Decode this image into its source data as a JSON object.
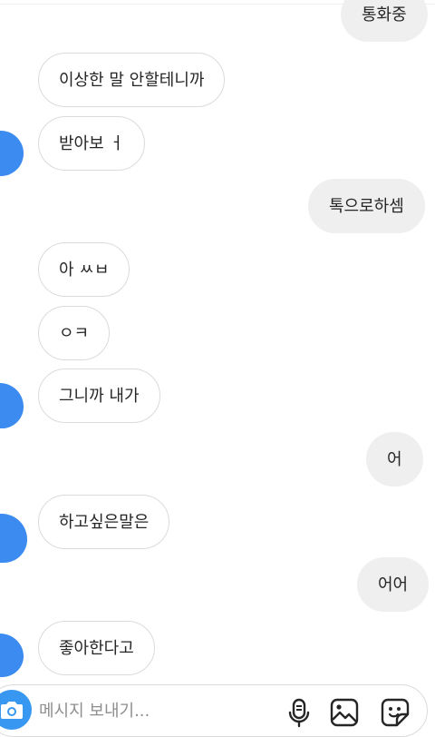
{
  "thread": {
    "messages": [
      {
        "side": "out",
        "text": "통화중"
      },
      {
        "side": "in",
        "text": "이상한 말 안할테니까"
      },
      {
        "side": "in",
        "text": "받아보 ㅓ"
      },
      {
        "side": "out",
        "text": "톡으로하셈"
      },
      {
        "side": "in",
        "text": "아 ㅆㅂ"
      },
      {
        "side": "in",
        "text": "ㅇㅋ"
      },
      {
        "side": "in",
        "text": "그니까 내가"
      },
      {
        "side": "out",
        "text": "어"
      },
      {
        "side": "in",
        "text": "하고싶은말은"
      },
      {
        "side": "out",
        "text": "어어"
      },
      {
        "side": "in",
        "text": "좋아한다고"
      }
    ]
  },
  "composer": {
    "placeholder": "메시지 보내기...",
    "value": "",
    "icons": [
      "camera-icon",
      "microphone-icon",
      "gallery-icon",
      "sticker-icon"
    ]
  },
  "colors": {
    "accent": "#3897f0",
    "avatar_scribble": "#3b8bf0",
    "incoming_border": "#dbdbdb",
    "outgoing_bg": "#efefef",
    "text": "#262626",
    "placeholder": "#8e8e8e"
  }
}
